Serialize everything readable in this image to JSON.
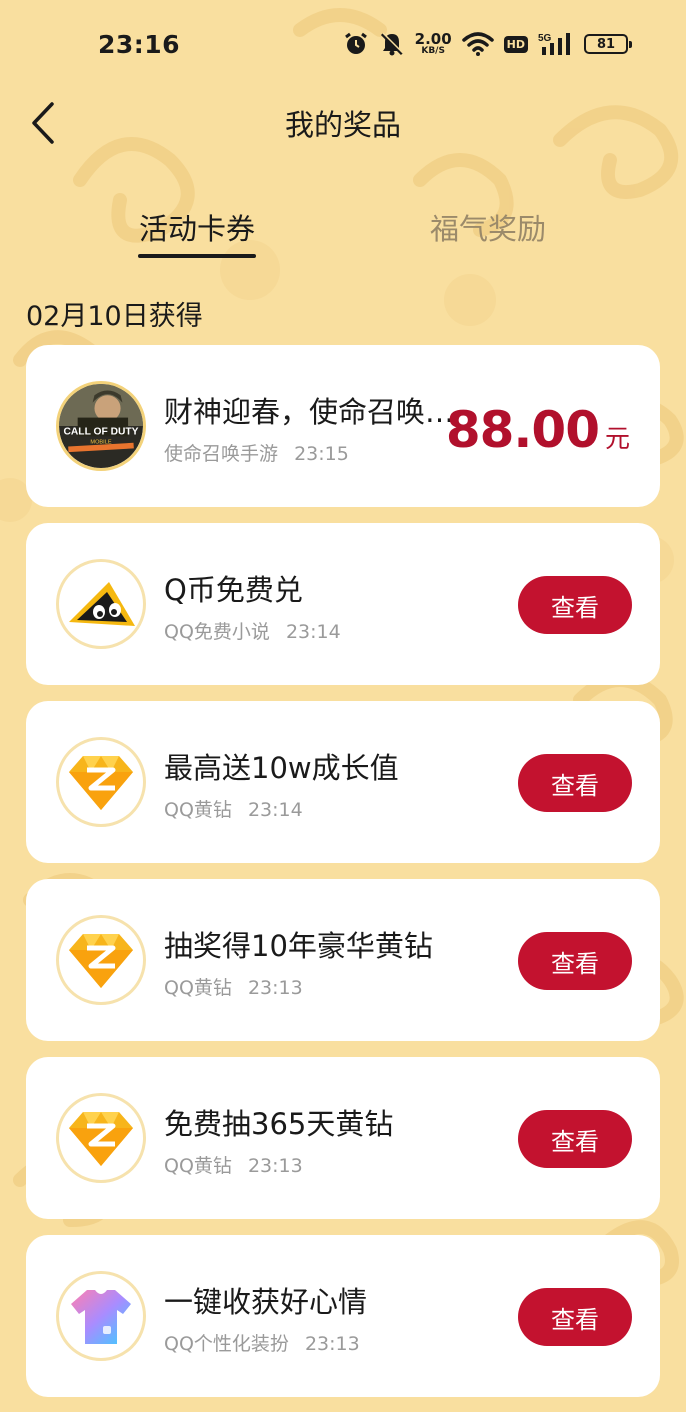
{
  "status_bar": {
    "time": "23:16",
    "net_speed_value": "2.00",
    "net_speed_unit": "KB/S",
    "hd_label": "HD",
    "network_label": "5G",
    "battery": "81",
    "icons": [
      "alarm-icon",
      "mute-icon",
      "wifi-icon",
      "signal-icon",
      "battery-icon"
    ]
  },
  "header": {
    "title": "我的奖品",
    "back_icon": "chevron-left-icon"
  },
  "tabs": [
    {
      "label": "活动卡券",
      "active": true
    },
    {
      "label": "福气奖励",
      "active": false
    }
  ],
  "section": {
    "date": "02月10日获得"
  },
  "prizes": [
    {
      "title": "财神迎春，使命召唤…",
      "source": "使命召唤手游",
      "time": "23:15",
      "amount": "88.00",
      "unit": "元",
      "icon": "call-of-duty-logo"
    },
    {
      "title": "Q币免费兑",
      "source": "QQ免费小说",
      "time": "23:14",
      "button": "查看",
      "icon": "qq-novel-icon"
    },
    {
      "title": "最高送10w成长值",
      "source": "QQ黄钻",
      "time": "23:14",
      "button": "查看",
      "icon": "yellow-diamond-icon"
    },
    {
      "title": "抽奖得10年豪华黄钻",
      "source": "QQ黄钻",
      "time": "23:13",
      "button": "查看",
      "icon": "yellow-diamond-icon"
    },
    {
      "title": "免费抽365天黄钻",
      "source": "QQ黄钻",
      "time": "23:13",
      "button": "查看",
      "icon": "yellow-diamond-icon"
    },
    {
      "title": "一键收获好心情",
      "source": "QQ个性化装扮",
      "time": "23:13",
      "button": "查看",
      "icon": "tshirt-icon"
    }
  ],
  "colors": {
    "background": "#f9df9f",
    "accent": "#c3122f",
    "price": "#b1102c"
  }
}
